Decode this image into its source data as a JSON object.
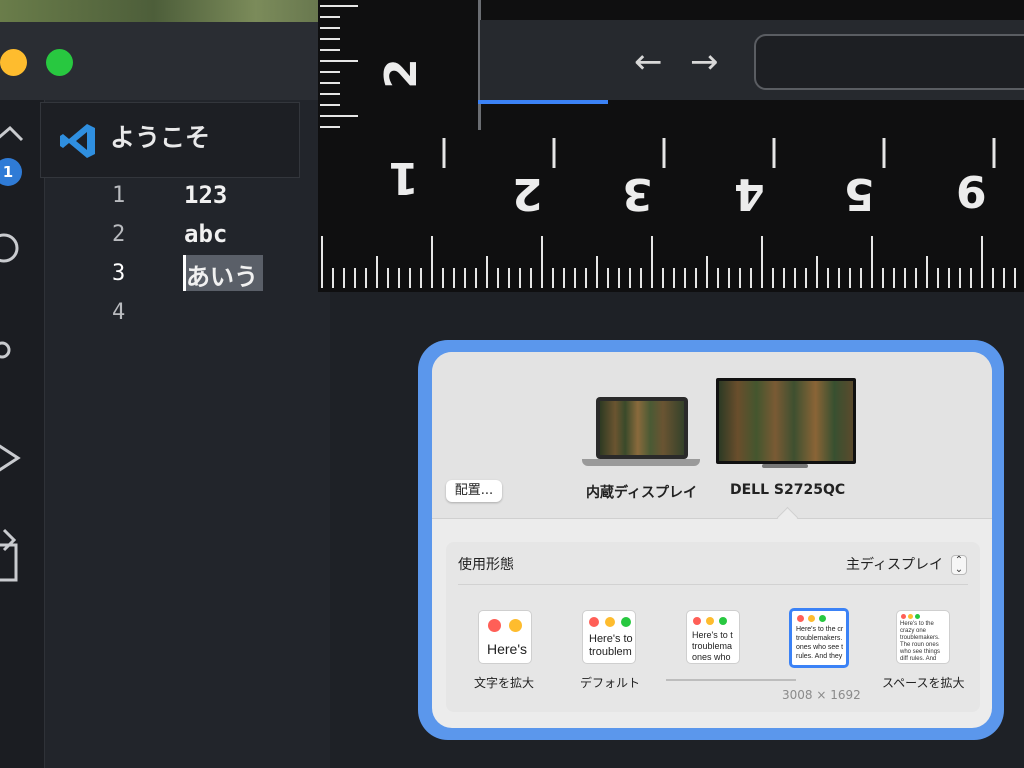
{
  "editor": {
    "tab_label": "ようこそ",
    "badge": "1",
    "lines": [
      {
        "num": "1",
        "text": "123"
      },
      {
        "num": "2",
        "text": "abc"
      },
      {
        "num": "3",
        "text": "あいう"
      },
      {
        "num": "4",
        "text": ""
      }
    ]
  },
  "ruler": {
    "top_number": "2",
    "numbers": [
      "1",
      "2",
      "3",
      "4",
      "5",
      "6"
    ]
  },
  "browser": {
    "back_icon": "←",
    "forward_icon": "→"
  },
  "display_settings": {
    "arrange_button": "配置...",
    "displays": [
      {
        "name": "内蔵ディスプレイ"
      },
      {
        "name": "DELL S2725QC"
      }
    ],
    "usage_label": "使用形態",
    "usage_value": "主ディスプレイ",
    "resolution_options": [
      {
        "label": "文字を拡大",
        "preview": "Here's"
      },
      {
        "label": "デフォルト",
        "preview": "Here's to troublem"
      },
      {
        "label": "",
        "preview": "Here's to t troublema ones who"
      },
      {
        "label": "",
        "preview": "Here's to the cr troublemakers. ones who see t rules. And they"
      },
      {
        "label": "スペースを拡大",
        "preview": "Here's to the crazy one troublemakers. The roun ones who see things diff rules. And they have no can quote them, disagre About the only thing yo Because they change th"
      }
    ],
    "resolution_text": "3008 × 1692",
    "selected_index": 3
  },
  "colors": {
    "accent": "#3b82f6",
    "frame": "#5b97ec",
    "close": "#ff5f57",
    "minimize": "#febc2e",
    "zoom": "#28c840"
  }
}
